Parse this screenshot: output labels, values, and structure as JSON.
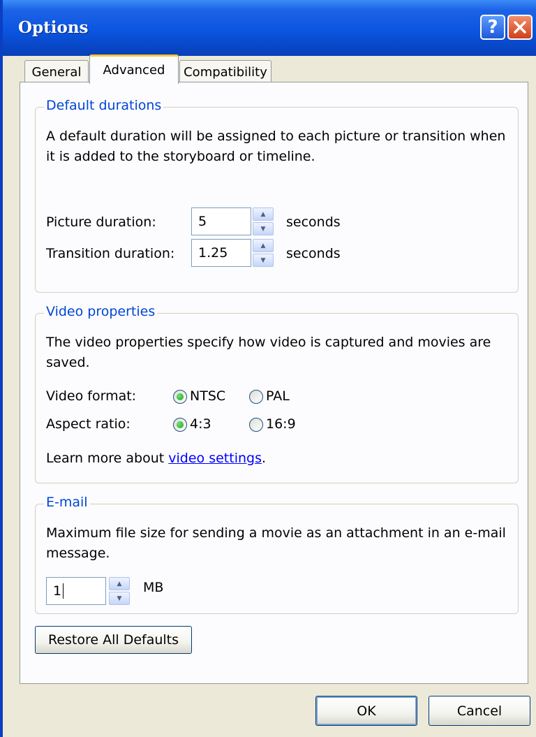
{
  "window": {
    "title": "Options"
  },
  "titlebar": {
    "help_label": "?"
  },
  "tabs": [
    {
      "label": "General"
    },
    {
      "label": "Advanced"
    },
    {
      "label": "Compatibility"
    }
  ],
  "default_durations": {
    "title": "Default durations",
    "description": [
      "A default duration will be assigned to each picture or transition when",
      "it is added to the storyboard or timeline."
    ],
    "picture_label": "Picture duration:",
    "picture_value": "5",
    "transition_label": "Transition duration:",
    "transition_value": "1.25",
    "unit": "seconds"
  },
  "video_properties": {
    "title": "Video properties",
    "description": [
      "The video properties specify how video is captured and movies are",
      "saved."
    ],
    "format_label": "Video format:",
    "format_options": [
      {
        "label": "NTSC",
        "checked": true
      },
      {
        "label": "PAL",
        "checked": false
      }
    ],
    "aspect_label": "Aspect ratio:",
    "aspect_options": [
      {
        "label": "4:3",
        "checked": true
      },
      {
        "label": "16:9",
        "checked": false
      }
    ],
    "learn_more_prefix": "Learn more about ",
    "learn_more_link": "video settings",
    "learn_more_suffix": "."
  },
  "email": {
    "title": "E-mail",
    "description": [
      "Maximum file size for sending a movie as an attachment in an e-mail",
      "message."
    ],
    "size_value": "1",
    "unit": "MB"
  },
  "buttons": {
    "restore": "Restore All Defaults",
    "ok": "OK",
    "cancel": "Cancel"
  }
}
